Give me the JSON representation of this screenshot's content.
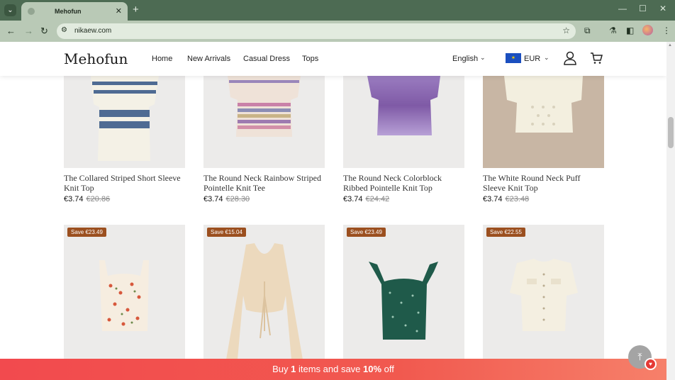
{
  "browser": {
    "tab_title": "Mehofun",
    "url": "nikaew.com"
  },
  "site": {
    "logo": "Mehofun",
    "nav": [
      "Home",
      "New Arrivals",
      "Casual Dress",
      "Tops"
    ],
    "language": "English",
    "currency": "EUR"
  },
  "products_row1": [
    {
      "name": "The Collared Striped Short Sleeve Knit Top",
      "price": "€3.74",
      "old_price": "€20.86"
    },
    {
      "name": "The Round Neck Rainbow Striped Pointelle Knit Tee",
      "price": "€3.74",
      "old_price": "€28.30"
    },
    {
      "name": "The Round Neck Colorblock Ribbed Pointelle Knit Top",
      "price": "€3.74",
      "old_price": "€24.42"
    },
    {
      "name": "The White Round Neck Puff Sleeve Knit Top",
      "price": "€3.74",
      "old_price": "€23.48"
    }
  ],
  "products_row2": [
    {
      "badge": "Save €23.49"
    },
    {
      "badge": "Save €15.04"
    },
    {
      "badge": "Save €23.49"
    },
    {
      "badge": "Save €22.55"
    }
  ],
  "promo": {
    "pre": "Buy ",
    "qty": "1",
    "mid": " items and save ",
    "pct": "10%",
    "post": " off"
  },
  "colors": {
    "promo": "#f24a4e",
    "badge": "#9b4f1f",
    "chrome": "#4d6b53"
  }
}
